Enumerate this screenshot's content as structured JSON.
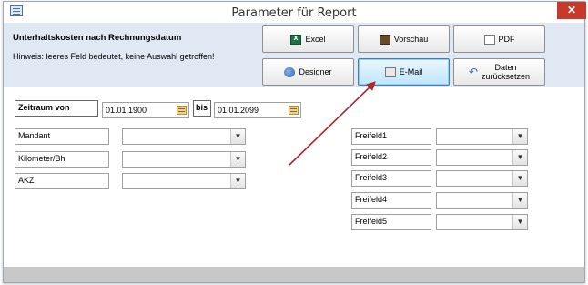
{
  "window": {
    "title": "Parameter für Report",
    "close_glyph": "✕"
  },
  "header": {
    "report_name": "Unterhaltskosten nach Rechnungsdatum",
    "hint": "Hinweis: leeres Feld bedeutet, keine Auswahl getroffen!"
  },
  "buttons": {
    "excel": "Excel",
    "preview": "Vorschau",
    "pdf": "PDF",
    "designer": "Designer",
    "email": "E-Mail",
    "reset_line1": "Daten",
    "reset_line2": "zurücksetzen"
  },
  "period": {
    "label_from": "Zeitraum von",
    "from_value": "01.01.1900",
    "label_to": "bis",
    "to_value": "01.01.2099"
  },
  "left_filters": [
    {
      "label": "Mandant",
      "value": ""
    },
    {
      "label": "Kilometer/Bh",
      "value": ""
    },
    {
      "label": "AKZ",
      "value": ""
    }
  ],
  "right_filters": [
    {
      "label": "Freifeld1",
      "value": ""
    },
    {
      "label": "Freifeld2",
      "value": ""
    },
    {
      "label": "Freifeld3",
      "value": ""
    },
    {
      "label": "Freifeld4",
      "value": ""
    },
    {
      "label": "Freifeld5",
      "value": ""
    }
  ],
  "colors": {
    "header_bg": "#dfe8f3",
    "close_red": "#c7392b",
    "arrow_red": "#b2232a",
    "footer_gray": "#c8c8c8"
  },
  "combo_arrow": "▼"
}
